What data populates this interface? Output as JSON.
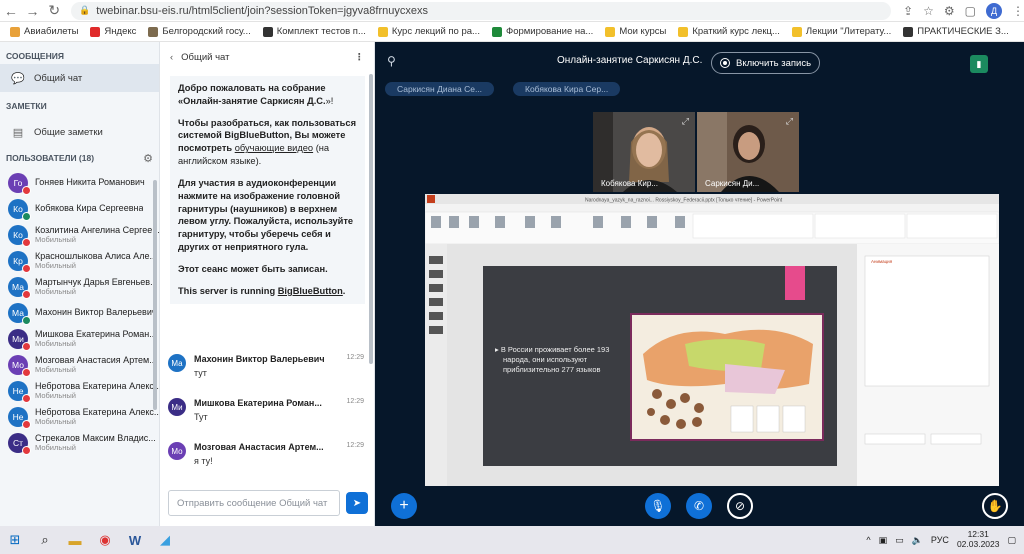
{
  "browser": {
    "url": "twebinar.bsu-eis.ru/html5client/join?sessionToken=jgyva8frnuycxexs",
    "profile_initial": "Д",
    "bookmarks": [
      {
        "label": "Авиабилеты",
        "color": "#e8a13a"
      },
      {
        "label": "Яндекс",
        "color": "#e02b2b"
      },
      {
        "label": "Белгородский госу...",
        "color": "#7d6b4f"
      },
      {
        "label": "Комплект тестов п...",
        "color": "#333333"
      },
      {
        "label": "Курс лекций по ра...",
        "color": "#f2c02b"
      },
      {
        "label": "Формирование на...",
        "color": "#1f8a3a"
      },
      {
        "label": "Мои курсы",
        "color": "#f2c02b"
      },
      {
        "label": "Краткий курс лекц...",
        "color": "#f2c02b"
      },
      {
        "label": "Лекции \"Литерату...",
        "color": "#f2c02b"
      },
      {
        "label": "ПРАКТИЧЕСКИЕ З...",
        "color": "#333333"
      }
    ]
  },
  "sidebar": {
    "messages_title": "СООБЩЕНИЯ",
    "public_chat": "Общий чат",
    "notes_title": "ЗАМЕТКИ",
    "shared_notes": "Общие заметки",
    "users_title": "ПОЛЬЗОВАТЕЛИ (18)",
    "users": [
      {
        "initials": "Го",
        "name": "Гоняев Никита Романович",
        "sub": "",
        "color": "#6b3fb4",
        "mic": "red"
      },
      {
        "initials": "Ко",
        "name": "Кобякова Кира Сергеевна",
        "sub": "",
        "color": "#1e72c4",
        "mic": "green"
      },
      {
        "initials": "Ко",
        "name": "Козлитина Ангелина Сергее...",
        "sub": "Мобильный",
        "color": "#1e72c4",
        "mic": "red"
      },
      {
        "initials": "Кр",
        "name": "Красношлыкова Алиса Але...",
        "sub": "Мобильный",
        "color": "#1e72c4",
        "mic": "red"
      },
      {
        "initials": "Ма",
        "name": "Мартынчук Дарья Евгеньев...",
        "sub": "Мобильный",
        "color": "#1e72c4",
        "mic": "red"
      },
      {
        "initials": "Ма",
        "name": "Махонин Виктор Валерьевич",
        "sub": "",
        "color": "#1e72c4",
        "mic": "green"
      },
      {
        "initials": "Ми",
        "name": "Мишкова Екатерина Роман...",
        "sub": "Мобильный",
        "color": "#3b2d86",
        "mic": "red"
      },
      {
        "initials": "Мо",
        "name": "Мозговая Анастасия Артем...",
        "sub": "Мобильный",
        "color": "#6b3fb4",
        "mic": "red"
      },
      {
        "initials": "Не",
        "name": "Небротова Екатерина Алекс...",
        "sub": "Мобильный",
        "color": "#1e72c4",
        "mic": "red"
      },
      {
        "initials": "Не",
        "name": "Небротова Екатерина Алекс...",
        "sub": "Мобильный",
        "color": "#1e72c4",
        "mic": "red"
      },
      {
        "initials": "Ст",
        "name": "Стрекалов Максим Владис...",
        "sub": "Мобильный",
        "color": "#3b2d86",
        "mic": "red"
      }
    ]
  },
  "chat": {
    "header": "Общий чат",
    "welcome_1": "Добро пожаловать на собрание «",
    "welcome_1_bold": "Онлайн-занятие Саркисян Д.С.",
    "welcome_1_end": "»!",
    "welcome_2a": "Чтобы разобраться, как пользоваться системой BigBlueButton, Вы можете посмотреть ",
    "welcome_2_link": "обучающие видео",
    "welcome_2b": " (на английском языке).",
    "welcome_3": "Для участия в аудиоконференции нажмите на изображение головной гарнитуры (наушников) в верхнем левом углу. Пожалуйста, используйте гарнитуру, чтобы уберечь себя и других от неприятного гула.",
    "welcome_4": "Этот сеанс может быть записан.",
    "welcome_5a": "This server is running ",
    "welcome_5_link": "BigBlueButton",
    "welcome_5b": ".",
    "messages": [
      {
        "initials": "Ма",
        "name": "Махонин Виктор Валерьевич",
        "time": "12:29",
        "text": "тут",
        "color": "#1e72c4"
      },
      {
        "initials": "Ми",
        "name": "Мишкова Екатерина Роман...",
        "time": "12:29",
        "text": "Тут",
        "color": "#3b2d86"
      },
      {
        "initials": "Мо",
        "name": "Мозговая Анастасия Артем...",
        "time": "12:29",
        "text": "я ту!",
        "color": "#6b3fb4"
      }
    ],
    "input_placeholder": "Отправить сообщение Общий чат"
  },
  "main": {
    "title": "Онлайн-занятие Саркисян Д.С.",
    "record_label": "Включить запись",
    "talkers": [
      "Саркисян Диана Се...",
      "Кобякова Кира Сер..."
    ],
    "cams": [
      "Кобякова Кир...",
      "Саркисян Ди..."
    ],
    "slide_text": "В России проживает более 193 народа, они используют приблизительно 277 языков",
    "ppt_title": "Narodnaya_yazyk_na_raznoi... Rossiyskoy_Federacii.pptx [Только чтение] - PowerPoint"
  },
  "taskbar": {
    "lang": "РУС",
    "time": "12:31",
    "date": "02.03.2023"
  }
}
